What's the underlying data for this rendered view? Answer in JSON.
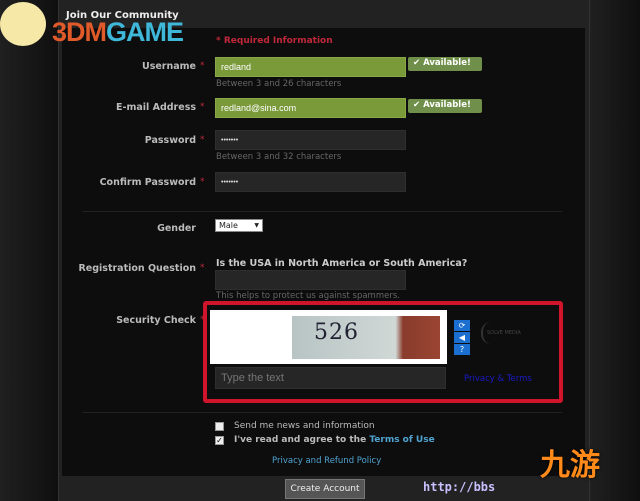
{
  "header": {
    "title": "Join Our Community"
  },
  "logo": {
    "text_a": "3DM",
    "text_b": "GAME"
  },
  "required_note": "* Required Information",
  "form": {
    "username": {
      "label": "Username",
      "value": "redland",
      "hint": "Between 3 and 26 characters",
      "status": "✔ Available!"
    },
    "email": {
      "label": "E-mail Address",
      "value": "redland@sina.com",
      "status": "✔ Available!"
    },
    "password": {
      "label": "Password",
      "value": "•••••••",
      "hint": "Between 3 and 32 characters"
    },
    "confirm": {
      "label": "Confirm Password",
      "value": "•••••••"
    },
    "gender": {
      "label": "Gender",
      "value": "Male"
    },
    "question": {
      "label": "Registration Question",
      "text": "Is the USA in North America or South America?",
      "value": "",
      "hint": "This helps to protect us against spammers."
    },
    "security": {
      "label": "Security Check",
      "captcha_text": "526",
      "placeholder": "Type the text",
      "privacy_terms": "Privacy & Terms",
      "brand": "SOLVE MEDIA"
    },
    "asterisk": "*",
    "news": {
      "label": "Send me news and information",
      "checked": false
    },
    "terms": {
      "label": "I've read and agree to the ",
      "link": "Terms of Use",
      "checked": true
    },
    "privacy_link": "Privacy and Refund Policy",
    "submit": "Create Account"
  },
  "watermark": {
    "brand": "九游",
    "url": "http://bbs"
  },
  "colors": {
    "accent_red": "#d0142c",
    "valid_green": "#7a9a3a",
    "link_blue": "#4fa3d1"
  }
}
